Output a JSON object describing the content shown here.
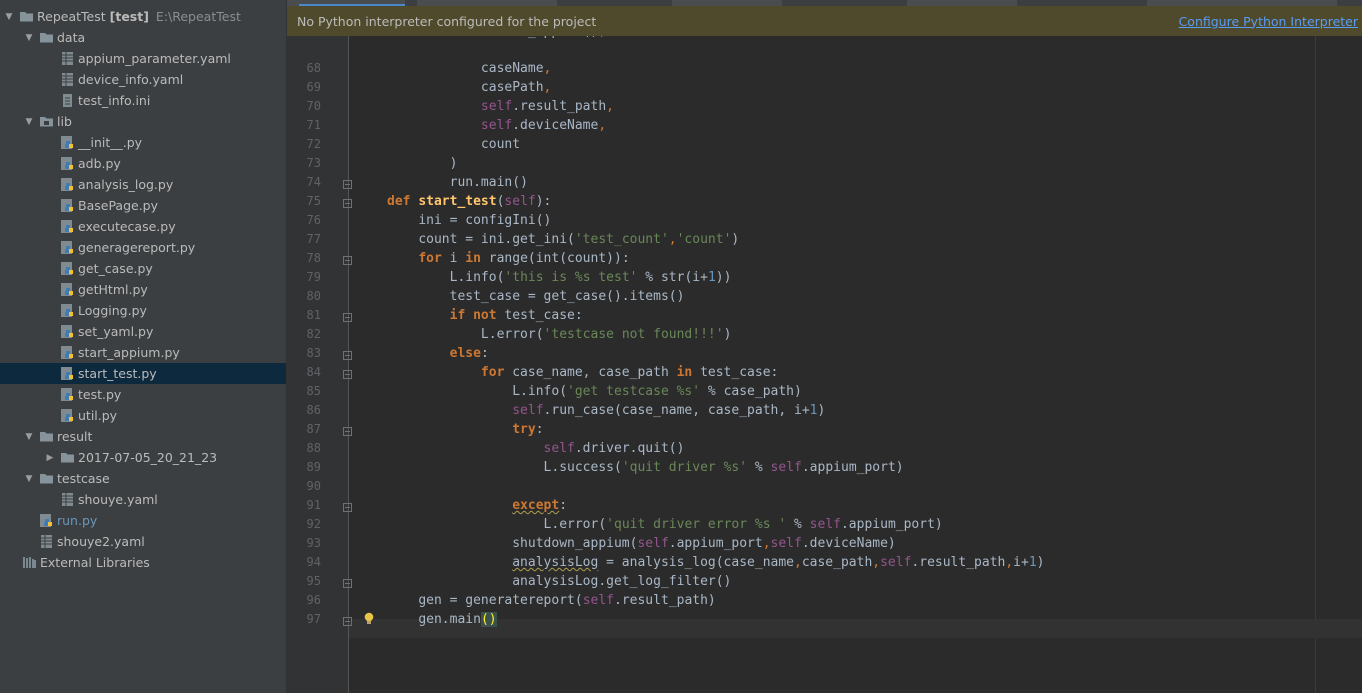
{
  "project_tree": {
    "root": {
      "name": "RepeatTest",
      "tag": "[test]",
      "path": "E:\\RepeatTest"
    },
    "rows": [
      {
        "label": "data",
        "type": "folder",
        "depth": 1,
        "expanded": true
      },
      {
        "label": "appium_parameter.yaml",
        "type": "yaml",
        "depth": 2
      },
      {
        "label": "device_info.yaml",
        "type": "yaml",
        "depth": 2
      },
      {
        "label": "test_info.ini",
        "type": "ini",
        "depth": 2
      },
      {
        "label": "lib",
        "type": "package",
        "depth": 1,
        "expanded": true
      },
      {
        "label": "__init__.py",
        "type": "py",
        "depth": 2
      },
      {
        "label": "adb.py",
        "type": "py",
        "depth": 2
      },
      {
        "label": "analysis_log.py",
        "type": "py",
        "depth": 2
      },
      {
        "label": "BasePage.py",
        "type": "py",
        "depth": 2
      },
      {
        "label": "executecase.py",
        "type": "py",
        "depth": 2
      },
      {
        "label": "generagereport.py",
        "type": "py",
        "depth": 2
      },
      {
        "label": "get_case.py",
        "type": "py",
        "depth": 2
      },
      {
        "label": "getHtml.py",
        "type": "py",
        "depth": 2
      },
      {
        "label": "Logging.py",
        "type": "py",
        "depth": 2
      },
      {
        "label": "set_yaml.py",
        "type": "py",
        "depth": 2
      },
      {
        "label": "start_appium.py",
        "type": "py",
        "depth": 2
      },
      {
        "label": "start_test.py",
        "type": "py",
        "depth": 2,
        "selected": true
      },
      {
        "label": "test.py",
        "type": "py",
        "depth": 2
      },
      {
        "label": "util.py",
        "type": "py",
        "depth": 2
      },
      {
        "label": "result",
        "type": "folder",
        "depth": 1,
        "expanded": true
      },
      {
        "label": "2017-07-05_20_21_23",
        "type": "folder",
        "depth": 2,
        "expanded": false
      },
      {
        "label": "testcase",
        "type": "folder",
        "depth": 1,
        "expanded": true
      },
      {
        "label": "shouye.yaml",
        "type": "yaml",
        "depth": 2
      },
      {
        "label": "run.py",
        "type": "py",
        "depth": 1,
        "accent": true
      },
      {
        "label": "shouye2.yaml",
        "type": "yaml",
        "depth": 1
      },
      {
        "label": "External Libraries",
        "type": "libs",
        "depth": 0
      }
    ]
  },
  "notification": {
    "message": "No Python interpreter configured for the project",
    "action": "Configure Python Interpreter"
  },
  "editor": {
    "first_partial_line": "        self.start_appium(),",
    "lines": [
      {
        "n": "68",
        "fold": false,
        "tokens": [
          [
            "            ",
            ""
          ],
          [
            "caseName",
            "v"
          ],
          [
            ",",
            "p"
          ]
        ]
      },
      {
        "n": "69",
        "fold": false,
        "tokens": [
          [
            "            ",
            ""
          ],
          [
            "casePath",
            "v"
          ],
          [
            ",",
            "p"
          ]
        ]
      },
      {
        "n": "70",
        "fold": false,
        "tokens": [
          [
            "            ",
            ""
          ],
          [
            "self",
            "s"
          ],
          [
            ".result_path",
            "v"
          ],
          [
            ",",
            "p"
          ]
        ]
      },
      {
        "n": "71",
        "fold": false,
        "tokens": [
          [
            "            ",
            ""
          ],
          [
            "self",
            "s"
          ],
          [
            ".deviceName",
            "v"
          ],
          [
            ",",
            "p"
          ]
        ]
      },
      {
        "n": "72",
        "fold": false,
        "tokens": [
          [
            "            ",
            ""
          ],
          [
            "count",
            "v"
          ]
        ]
      },
      {
        "n": "73",
        "fold": false,
        "tokens": [
          [
            "        ",
            ""
          ],
          [
            ")",
            "v"
          ]
        ]
      },
      {
        "n": "74",
        "fold": true,
        "tokens": [
          [
            "        ",
            ""
          ],
          [
            "run.main()",
            "v"
          ]
        ]
      },
      {
        "n": "75",
        "fold": true,
        "tokens": [
          [
            "def",
            "k"
          ],
          [
            " ",
            ""
          ],
          [
            "start_test",
            "f"
          ],
          [
            "(",
            "v"
          ],
          [
            "self",
            "s"
          ],
          [
            "):",
            "v"
          ]
        ]
      },
      {
        "n": "76",
        "fold": false,
        "tokens": [
          [
            "    ",
            ""
          ],
          [
            "ini = configIni()",
            "v"
          ]
        ]
      },
      {
        "n": "77",
        "fold": false,
        "tokens": [
          [
            "    ",
            ""
          ],
          [
            "count = ini.get_ini(",
            "v"
          ],
          [
            "'test_count'",
            "t"
          ],
          [
            ",",
            "p"
          ],
          [
            "'count'",
            "t"
          ],
          [
            ")",
            "v"
          ]
        ]
      },
      {
        "n": "78",
        "fold": true,
        "tokens": [
          [
            "    ",
            ""
          ],
          [
            "for",
            "k"
          ],
          [
            " i ",
            "v"
          ],
          [
            "in",
            "k"
          ],
          [
            " range(int(count)):",
            "v"
          ]
        ]
      },
      {
        "n": "79",
        "fold": false,
        "tokens": [
          [
            "        ",
            ""
          ],
          [
            "L.info(",
            "v"
          ],
          [
            "'this is %s test'",
            "t"
          ],
          [
            " % str(i+",
            "v"
          ],
          [
            "1",
            "n"
          ],
          [
            "))",
            "v"
          ]
        ]
      },
      {
        "n": "80",
        "fold": false,
        "tokens": [
          [
            "        ",
            ""
          ],
          [
            "test_case = get_case().items()",
            "v"
          ]
        ]
      },
      {
        "n": "81",
        "fold": true,
        "tokens": [
          [
            "        ",
            ""
          ],
          [
            "if",
            "k"
          ],
          [
            " ",
            ""
          ],
          [
            "not",
            "k"
          ],
          [
            " test_case:",
            "v"
          ]
        ]
      },
      {
        "n": "82",
        "fold": false,
        "tokens": [
          [
            "            ",
            ""
          ],
          [
            "L.error(",
            "v"
          ],
          [
            "'testcase not found!!!'",
            "t"
          ],
          [
            ")",
            "v"
          ]
        ]
      },
      {
        "n": "83",
        "fold": true,
        "tokens": [
          [
            "        ",
            ""
          ],
          [
            "else",
            "k"
          ],
          [
            ":",
            "v"
          ]
        ]
      },
      {
        "n": "84",
        "fold": true,
        "tokens": [
          [
            "            ",
            ""
          ],
          [
            "for",
            "k"
          ],
          [
            " case_name, case_path ",
            "v"
          ],
          [
            "in",
            "k"
          ],
          [
            " test_case:",
            "v"
          ]
        ]
      },
      {
        "n": "85",
        "fold": false,
        "tokens": [
          [
            "                ",
            ""
          ],
          [
            "L.info(",
            "v"
          ],
          [
            "'get testcase %s'",
            "t"
          ],
          [
            " % case_path)",
            "v"
          ]
        ]
      },
      {
        "n": "86",
        "fold": false,
        "tokens": [
          [
            "                ",
            ""
          ],
          [
            "self",
            "s"
          ],
          [
            ".run_case(case_name, case_path, i+",
            "v"
          ],
          [
            "1",
            "n"
          ],
          [
            ")",
            "v"
          ]
        ]
      },
      {
        "n": "87",
        "fold": true,
        "tokens": [
          [
            "                ",
            ""
          ],
          [
            "try",
            "k"
          ],
          [
            ":",
            "v"
          ]
        ]
      },
      {
        "n": "88",
        "fold": false,
        "tokens": [
          [
            "                    ",
            ""
          ],
          [
            "self",
            "s"
          ],
          [
            ".driver.quit()",
            "v"
          ]
        ]
      },
      {
        "n": "89",
        "fold": false,
        "tokens": [
          [
            "                    ",
            ""
          ],
          [
            "L.success(",
            "v"
          ],
          [
            "'quit driver %s'",
            "t"
          ],
          [
            " % ",
            "v"
          ],
          [
            "self",
            "s"
          ],
          [
            ".appium_port)",
            "v"
          ]
        ]
      },
      {
        "n": "90",
        "fold": false,
        "tokens": []
      },
      {
        "n": "91",
        "fold": true,
        "tokens": [
          [
            "                ",
            ""
          ],
          [
            "except",
            "kw"
          ],
          [
            ":",
            "v"
          ]
        ]
      },
      {
        "n": "92",
        "fold": false,
        "tokens": [
          [
            "                    ",
            ""
          ],
          [
            "L.error(",
            "v"
          ],
          [
            "'quit driver error %s '",
            "t"
          ],
          [
            " % ",
            "v"
          ],
          [
            "self",
            "s"
          ],
          [
            ".appium_port)",
            "v"
          ]
        ]
      },
      {
        "n": "93",
        "fold": false,
        "tokens": [
          [
            "                ",
            ""
          ],
          [
            "shutdown_appium(",
            "v"
          ],
          [
            "self",
            "s"
          ],
          [
            ".appium_port",
            "v"
          ],
          [
            ",",
            "p"
          ],
          [
            "self",
            "s"
          ],
          [
            ".deviceName)",
            "v"
          ]
        ]
      },
      {
        "n": "94",
        "fold": false,
        "tokens": [
          [
            "                ",
            ""
          ],
          [
            "analysisLog",
            "vw"
          ],
          [
            " = analysis_log(case_name",
            "v"
          ],
          [
            ",",
            "p"
          ],
          [
            "case_path",
            "v"
          ],
          [
            ",",
            "p"
          ],
          [
            "self",
            "s"
          ],
          [
            ".result_path",
            "v"
          ],
          [
            ",",
            "p"
          ],
          [
            "i+",
            "v"
          ],
          [
            "1",
            "n"
          ],
          [
            ")",
            "v"
          ]
        ]
      },
      {
        "n": "95",
        "fold": true,
        "tokens": [
          [
            "                ",
            ""
          ],
          [
            "analysisLog.get_log_filter()",
            "v"
          ]
        ]
      },
      {
        "n": "96",
        "fold": false,
        "tokens": [
          [
            "    ",
            ""
          ],
          [
            "gen = generatereport(",
            "v"
          ],
          [
            "self",
            "s"
          ],
          [
            ".result_path)",
            "v"
          ]
        ]
      },
      {
        "n": "97",
        "fold": true,
        "bulb": true,
        "tokens": [
          [
            "    ",
            ""
          ],
          [
            "gen.main",
            "v"
          ],
          [
            "()",
            "b"
          ]
        ]
      }
    ]
  }
}
